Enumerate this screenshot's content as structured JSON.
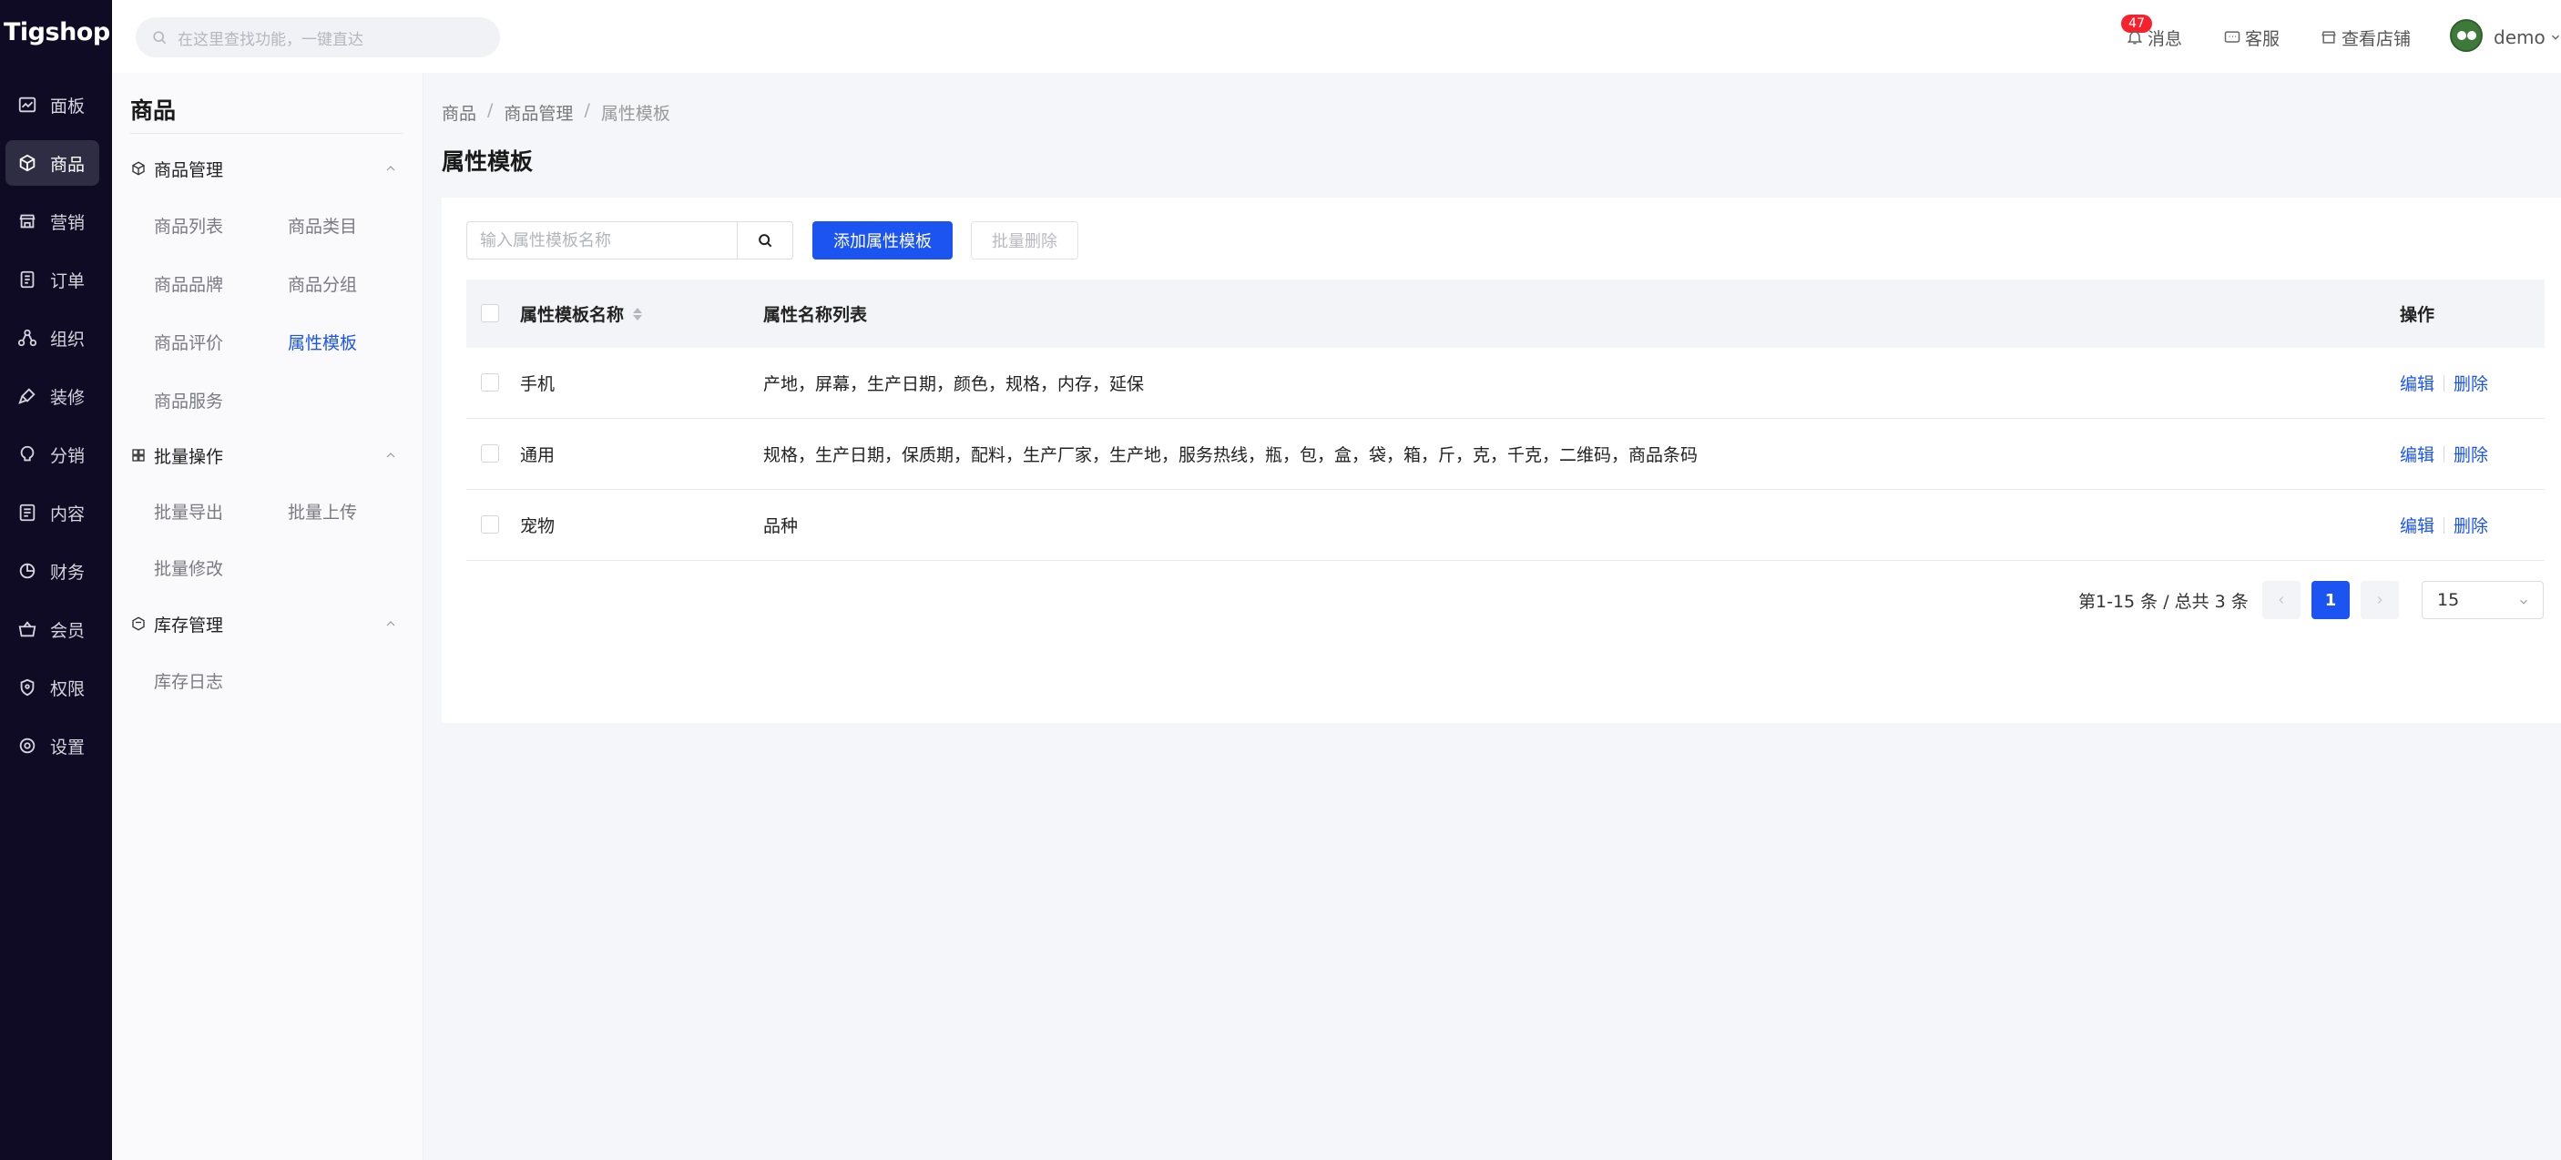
{
  "brand": {
    "logo_text": "Tigshop",
    "accent": "#1b54f0",
    "rail_bg": "#0f0b24"
  },
  "rail": {
    "items": [
      {
        "label": "面板",
        "icon": "dashboard-icon"
      },
      {
        "label": "商品",
        "icon": "box-icon",
        "active": true
      },
      {
        "label": "营销",
        "icon": "shop-icon"
      },
      {
        "label": "订单",
        "icon": "order-icon"
      },
      {
        "label": "组织",
        "icon": "org-icon"
      },
      {
        "label": "装修",
        "icon": "brush-icon"
      },
      {
        "label": "分销",
        "icon": "share-icon"
      },
      {
        "label": "内容",
        "icon": "content-icon"
      },
      {
        "label": "财务",
        "icon": "chart-pie-icon"
      },
      {
        "label": "会员",
        "icon": "basket-icon"
      },
      {
        "label": "权限",
        "icon": "shield-icon"
      },
      {
        "label": "设置",
        "icon": "settings-icon"
      }
    ]
  },
  "topbar": {
    "search_placeholder": "在这里查找功能，一键直达",
    "notify_count": "47",
    "notify_label": "消息",
    "service_label": "客服",
    "store_label": "查看店铺",
    "user_name": "demo"
  },
  "submenu": {
    "title": "商品",
    "groups": [
      {
        "title": "商品管理",
        "items": [
          "商品列表",
          "商品类目",
          "商品品牌",
          "商品分组",
          "商品评价",
          "属性模板",
          "商品服务"
        ]
      },
      {
        "title": "批量操作",
        "items": [
          "批量导出",
          "批量上传",
          "批量修改"
        ]
      },
      {
        "title": "库存管理",
        "items": [
          "库存日志"
        ]
      }
    ],
    "active_item": "属性模板"
  },
  "breadcrumb": [
    "商品",
    "商品管理",
    "属性模板"
  ],
  "breadcrumb_sep": "/",
  "page_title": "属性模板",
  "toolbar": {
    "filter_placeholder": "输入属性模板名称",
    "add_label": "添加属性模板",
    "batch_delete_label": "批量删除"
  },
  "table": {
    "columns": [
      "属性模板名称",
      "属性名称列表",
      "操作"
    ],
    "rows": [
      {
        "name": "手机",
        "attrs": "产地，屏幕，生产日期，颜色，规格，内存，延保"
      },
      {
        "name": "通用",
        "attrs": "规格，生产日期，保质期，配料，生产厂家，生产地，服务热线，瓶，包，盒，袋，箱，斤，克，千克，二维码，商品条码"
      },
      {
        "name": "宠物",
        "attrs": "品种"
      }
    ],
    "edit_label": "编辑",
    "delete_label": "删除"
  },
  "pagination": {
    "summary": "第1-15 条 / 总共 3 条",
    "current_page": "1",
    "page_size": "15"
  }
}
